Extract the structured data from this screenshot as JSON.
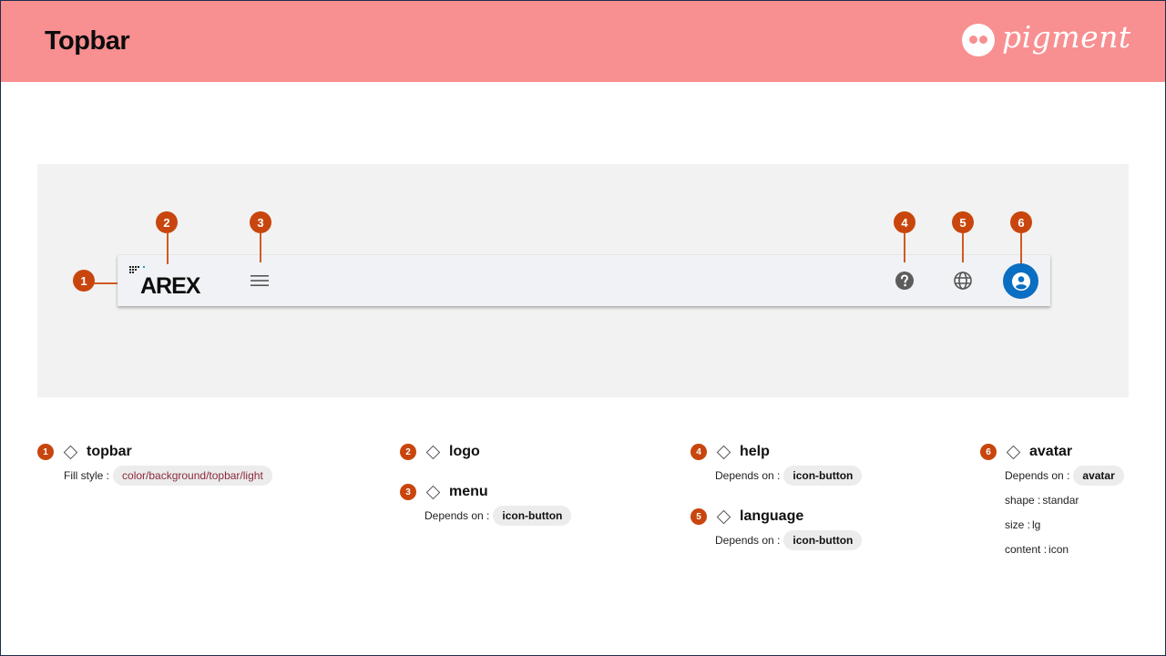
{
  "header": {
    "title": "Topbar",
    "brand_name": "pigment",
    "brand_color": "#f88f91"
  },
  "preview": {
    "logo_text": "AREX",
    "menu_icon": "hamburger-icon",
    "help_icon": "help-circle-icon",
    "language_icon": "globe-icon",
    "avatar_icon": "user-circle-icon",
    "avatar_color": "#0a6ec2",
    "callout_color": "#c8460d"
  },
  "callouts": [
    "1",
    "2",
    "3",
    "4",
    "5",
    "6"
  ],
  "specs": {
    "topbar": {
      "num": "1",
      "title": "topbar",
      "fill_label": "Fill style :",
      "fill_value": "color/background/topbar/light"
    },
    "logo": {
      "num": "2",
      "title": "logo"
    },
    "menu": {
      "num": "3",
      "title": "menu",
      "dep_label": "Depends on :",
      "dep_value": "icon-button"
    },
    "help": {
      "num": "4",
      "title": "help",
      "dep_label": "Depends on :",
      "dep_value": "icon-button"
    },
    "language": {
      "num": "5",
      "title": "language",
      "dep_label": "Depends on :",
      "dep_value": "icon-button"
    },
    "avatar": {
      "num": "6",
      "title": "avatar",
      "dep_label": "Depends on :",
      "dep_value": "avatar",
      "shape_label": "shape :",
      "shape_value": "standar",
      "size_label": "size :",
      "size_value": "lg",
      "content_label": "content :",
      "content_value": "icon"
    }
  }
}
